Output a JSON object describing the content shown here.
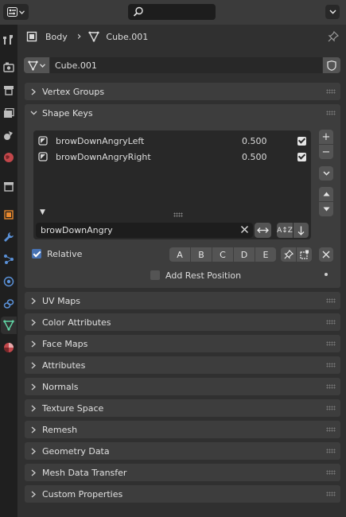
{
  "header": {
    "editor_type_icon": "properties-icon",
    "search_icon": "magnifier-icon",
    "options_icon": "chevron-down-icon"
  },
  "tabs": [
    {
      "name": "tool",
      "icon": "tool-icon"
    },
    {
      "name": "render",
      "icon": "render-icon"
    },
    {
      "name": "output",
      "icon": "output-icon"
    },
    {
      "name": "view-layer",
      "icon": "view-layer-icon"
    },
    {
      "name": "scene",
      "icon": "scene-icon"
    },
    {
      "name": "world",
      "icon": "world-icon"
    },
    {
      "name": "collection",
      "icon": "collection-icon"
    },
    {
      "name": "object",
      "icon": "object-icon"
    },
    {
      "name": "modifiers",
      "icon": "wrench-icon"
    },
    {
      "name": "particles",
      "icon": "particles-icon"
    },
    {
      "name": "physics",
      "icon": "physics-icon"
    },
    {
      "name": "constraints",
      "icon": "constraints-icon"
    },
    {
      "name": "data",
      "icon": "mesh-data-icon",
      "active": true
    },
    {
      "name": "material",
      "icon": "material-icon"
    }
  ],
  "breadcrumb": {
    "object": "Body",
    "separator": "›",
    "mesh": "Cube.001"
  },
  "datablock": {
    "name": "Cube.001"
  },
  "panels": {
    "vertex_groups": "Vertex Groups",
    "shape_keys": "Shape Keys",
    "collapsed": [
      "UV Maps",
      "Color Attributes",
      "Face Maps",
      "Attributes",
      "Normals",
      "Texture Space",
      "Remesh",
      "Geometry Data",
      "Mesh Data Transfer",
      "Custom Properties"
    ]
  },
  "shape_keys": {
    "items": [
      {
        "name": "browDownAngryLeft",
        "value": "0.500",
        "enabled": true
      },
      {
        "name": "browDownAngryRight",
        "value": "0.500",
        "enabled": true
      }
    ],
    "filter_value": "browDownAngry",
    "sort_alpha_label": "A↕Z",
    "add_label": "+",
    "remove_label": "−",
    "relative_label": "Relative",
    "relative_checked": true,
    "letter_buttons": [
      "A",
      "B",
      "C",
      "D",
      "E"
    ],
    "add_rest_position_label": "Add Rest Position",
    "add_rest_position_checked": false
  },
  "colors": {
    "accent": "#4772b3",
    "active_tab_icon": "#5fd2a2",
    "panel_bg": "#3d3d3d",
    "list_bg": "#282828",
    "button_bg": "#545454"
  }
}
